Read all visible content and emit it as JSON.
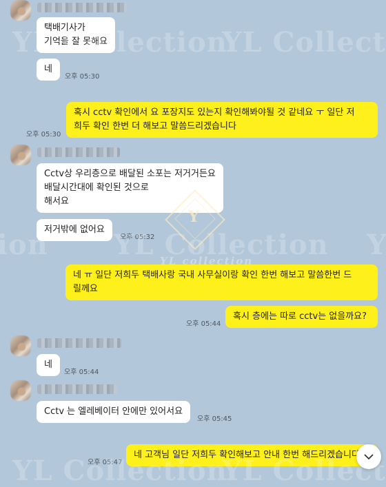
{
  "watermark": {
    "brand": "YL Collection",
    "brand_small": "YL collection",
    "logo_letter": "Y"
  },
  "messages": [
    {
      "side": "in",
      "lines": [
        "택배기사가",
        "기억을 잘 못해요"
      ],
      "time": ""
    },
    {
      "side": "in",
      "lines": [
        "네"
      ],
      "time": "오후 05:30"
    },
    {
      "side": "out",
      "lines": [
        "혹시 cctv 확인에서 요 포장지도 있는지 확인해봐야될 것 같네요 ㅜ 일단 저",
        "희두 확인 한번 더 해보고 말씀드리겠습니다"
      ],
      "time": "오후 05:30"
    },
    {
      "side": "in",
      "lines": [
        "Cctv상 우리층으로 배달된 소포는 저거거든요",
        "배달시간대에 확인된 것으로",
        "해서요"
      ],
      "time": ""
    },
    {
      "side": "in",
      "lines": [
        "저거밖에 없어요"
      ],
      "time": "오후 05:32"
    },
    {
      "side": "out",
      "lines": [
        "네 ㅠ 일단 저희두 택배사랑 국내 사무실이랑 확인 한번 해보고 말씀한번 드",
        "릴께요"
      ],
      "time": ""
    },
    {
      "side": "out",
      "lines": [
        "혹시 층에는 따로 cctv는 없을까요?"
      ],
      "time": "오후 05:44"
    },
    {
      "side": "in",
      "lines": [
        "네"
      ],
      "time": "오후 05:44"
    },
    {
      "side": "in",
      "lines": [
        "Cctv 는 엘레베이터 안에만 있어서요"
      ],
      "time": "오후 05:45"
    },
    {
      "side": "out",
      "lines": [
        "네 고객님 일단 저희두 확인해보고 안내 한번 해드리겠습니다"
      ],
      "time": "오후 05:47"
    }
  ],
  "colors": {
    "background": "#b2c7d9",
    "incoming_bubble": "#ffffff",
    "outgoing_bubble": "#fef01b"
  },
  "icons": {
    "scroll_down": "chevron-down-icon"
  }
}
